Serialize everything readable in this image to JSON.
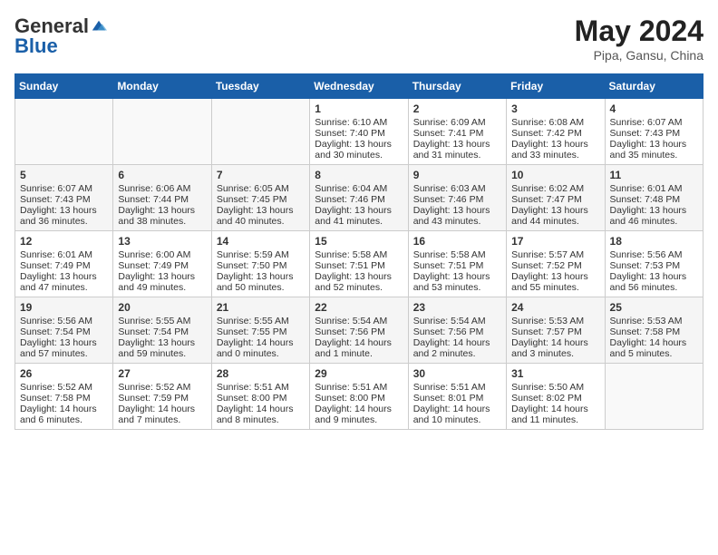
{
  "header": {
    "logo_general": "General",
    "logo_blue": "Blue",
    "month": "May 2024",
    "location": "Pipa, Gansu, China"
  },
  "days_of_week": [
    "Sunday",
    "Monday",
    "Tuesday",
    "Wednesday",
    "Thursday",
    "Friday",
    "Saturday"
  ],
  "weeks": [
    [
      {
        "day": "",
        "info": ""
      },
      {
        "day": "",
        "info": ""
      },
      {
        "day": "",
        "info": ""
      },
      {
        "day": "1",
        "info": "Sunrise: 6:10 AM\nSunset: 7:40 PM\nDaylight: 13 hours\nand 30 minutes."
      },
      {
        "day": "2",
        "info": "Sunrise: 6:09 AM\nSunset: 7:41 PM\nDaylight: 13 hours\nand 31 minutes."
      },
      {
        "day": "3",
        "info": "Sunrise: 6:08 AM\nSunset: 7:42 PM\nDaylight: 13 hours\nand 33 minutes."
      },
      {
        "day": "4",
        "info": "Sunrise: 6:07 AM\nSunset: 7:43 PM\nDaylight: 13 hours\nand 35 minutes."
      }
    ],
    [
      {
        "day": "5",
        "info": "Sunrise: 6:07 AM\nSunset: 7:43 PM\nDaylight: 13 hours\nand 36 minutes."
      },
      {
        "day": "6",
        "info": "Sunrise: 6:06 AM\nSunset: 7:44 PM\nDaylight: 13 hours\nand 38 minutes."
      },
      {
        "day": "7",
        "info": "Sunrise: 6:05 AM\nSunset: 7:45 PM\nDaylight: 13 hours\nand 40 minutes."
      },
      {
        "day": "8",
        "info": "Sunrise: 6:04 AM\nSunset: 7:46 PM\nDaylight: 13 hours\nand 41 minutes."
      },
      {
        "day": "9",
        "info": "Sunrise: 6:03 AM\nSunset: 7:46 PM\nDaylight: 13 hours\nand 43 minutes."
      },
      {
        "day": "10",
        "info": "Sunrise: 6:02 AM\nSunset: 7:47 PM\nDaylight: 13 hours\nand 44 minutes."
      },
      {
        "day": "11",
        "info": "Sunrise: 6:01 AM\nSunset: 7:48 PM\nDaylight: 13 hours\nand 46 minutes."
      }
    ],
    [
      {
        "day": "12",
        "info": "Sunrise: 6:01 AM\nSunset: 7:49 PM\nDaylight: 13 hours\nand 47 minutes."
      },
      {
        "day": "13",
        "info": "Sunrise: 6:00 AM\nSunset: 7:49 PM\nDaylight: 13 hours\nand 49 minutes."
      },
      {
        "day": "14",
        "info": "Sunrise: 5:59 AM\nSunset: 7:50 PM\nDaylight: 13 hours\nand 50 minutes."
      },
      {
        "day": "15",
        "info": "Sunrise: 5:58 AM\nSunset: 7:51 PM\nDaylight: 13 hours\nand 52 minutes."
      },
      {
        "day": "16",
        "info": "Sunrise: 5:58 AM\nSunset: 7:51 PM\nDaylight: 13 hours\nand 53 minutes."
      },
      {
        "day": "17",
        "info": "Sunrise: 5:57 AM\nSunset: 7:52 PM\nDaylight: 13 hours\nand 55 minutes."
      },
      {
        "day": "18",
        "info": "Sunrise: 5:56 AM\nSunset: 7:53 PM\nDaylight: 13 hours\nand 56 minutes."
      }
    ],
    [
      {
        "day": "19",
        "info": "Sunrise: 5:56 AM\nSunset: 7:54 PM\nDaylight: 13 hours\nand 57 minutes."
      },
      {
        "day": "20",
        "info": "Sunrise: 5:55 AM\nSunset: 7:54 PM\nDaylight: 13 hours\nand 59 minutes."
      },
      {
        "day": "21",
        "info": "Sunrise: 5:55 AM\nSunset: 7:55 PM\nDaylight: 14 hours\nand 0 minutes."
      },
      {
        "day": "22",
        "info": "Sunrise: 5:54 AM\nSunset: 7:56 PM\nDaylight: 14 hours\nand 1 minute."
      },
      {
        "day": "23",
        "info": "Sunrise: 5:54 AM\nSunset: 7:56 PM\nDaylight: 14 hours\nand 2 minutes."
      },
      {
        "day": "24",
        "info": "Sunrise: 5:53 AM\nSunset: 7:57 PM\nDaylight: 14 hours\nand 3 minutes."
      },
      {
        "day": "25",
        "info": "Sunrise: 5:53 AM\nSunset: 7:58 PM\nDaylight: 14 hours\nand 5 minutes."
      }
    ],
    [
      {
        "day": "26",
        "info": "Sunrise: 5:52 AM\nSunset: 7:58 PM\nDaylight: 14 hours\nand 6 minutes."
      },
      {
        "day": "27",
        "info": "Sunrise: 5:52 AM\nSunset: 7:59 PM\nDaylight: 14 hours\nand 7 minutes."
      },
      {
        "day": "28",
        "info": "Sunrise: 5:51 AM\nSunset: 8:00 PM\nDaylight: 14 hours\nand 8 minutes."
      },
      {
        "day": "29",
        "info": "Sunrise: 5:51 AM\nSunset: 8:00 PM\nDaylight: 14 hours\nand 9 minutes."
      },
      {
        "day": "30",
        "info": "Sunrise: 5:51 AM\nSunset: 8:01 PM\nDaylight: 14 hours\nand 10 minutes."
      },
      {
        "day": "31",
        "info": "Sunrise: 5:50 AM\nSunset: 8:02 PM\nDaylight: 14 hours\nand 11 minutes."
      },
      {
        "day": "",
        "info": ""
      }
    ]
  ]
}
